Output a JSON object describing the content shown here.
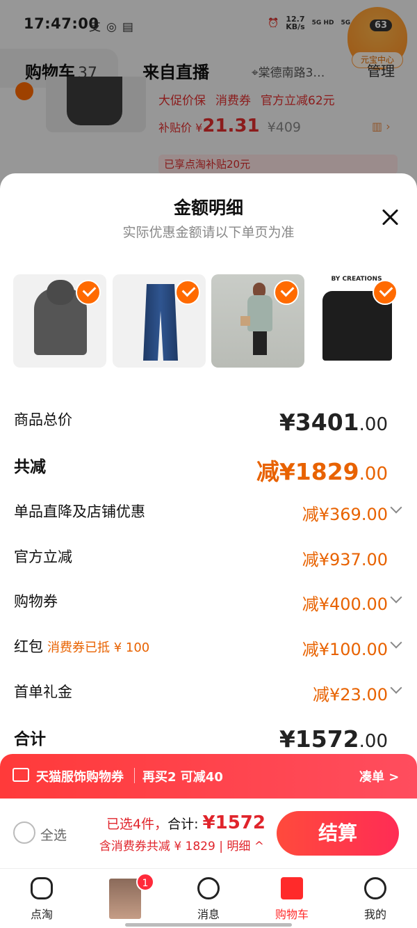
{
  "status_bar": {
    "time": "17:47:00",
    "speed_value": "12.7",
    "speed_unit": "KB/s",
    "network1": "5G HD",
    "network2": "5G HD",
    "icons": [
      "alipay-icon",
      "wechat-icon",
      "notification-icon",
      "alarm-icon",
      "wifi-icon"
    ]
  },
  "floating_badge": {
    "count": "63",
    "label": "元宝中心"
  },
  "header": {
    "tab_cart_label": "购物车",
    "tab_cart_count": "37",
    "tab_live_label": "来自直播",
    "address": "棠德南路3…",
    "manage_label": "管理"
  },
  "background_item": {
    "tags": [
      "大促价保",
      "消费券",
      "官方立减62元"
    ],
    "price_prefix": "补贴价",
    "price_symbol": "¥",
    "price": "21.31",
    "original_price": "¥409",
    "subsidy_note": "已享点淘补贴20元"
  },
  "sheet": {
    "title": "金额明细",
    "subtitle": "实际优惠金额请以下单页为准",
    "thumbnails": [
      {
        "name": "hoodie"
      },
      {
        "name": "jeans"
      },
      {
        "name": "model-photo"
      },
      {
        "name": "sweater",
        "brand_text": "BY CREATIONS"
      }
    ],
    "rows": [
      {
        "label": "商品总价",
        "value": "¥3401",
        "cents": ".00",
        "style": "total"
      },
      {
        "label": "共减",
        "value": "减¥1829",
        "cents": ".00",
        "style": "discount-total"
      },
      {
        "label": "单品直降及店铺优惠",
        "value": "减¥369",
        "cents": ".00",
        "expandable": true
      },
      {
        "label": "官方立减",
        "value": "减¥937",
        "cents": ".00",
        "expandable": false
      },
      {
        "label": "购物券",
        "value": "减¥400",
        "cents": ".00",
        "expandable": true
      },
      {
        "label": "红包",
        "note": "消费券已抵 ¥ 100",
        "value": "减¥100",
        "cents": ".00",
        "expandable": true
      },
      {
        "label": "首单礼金",
        "value": "减¥23",
        "cents": ".00",
        "expandable": true
      },
      {
        "label": "合计",
        "value": "¥1572",
        "cents": ".00",
        "style": "total"
      }
    ]
  },
  "coupon_banner": {
    "title": "天猫服饰购物券",
    "offer": "再买2 可减40",
    "action": "凑单 >"
  },
  "checkout": {
    "select_all": "全选",
    "selected_text": "已选4件，",
    "total_label": "合计:",
    "total_value": "¥1572",
    "discount_note": "含消费券共减 ¥ 1829 | 明细 ^",
    "pay_button": "结算"
  },
  "bottom_nav": {
    "items": [
      {
        "label": "点淘"
      },
      {
        "label": ""
      },
      {
        "label": "消息"
      },
      {
        "label": "购物车",
        "active": true
      },
      {
        "label": "我的"
      }
    ],
    "badge": "1"
  },
  "colors": {
    "accent": "#e86200",
    "red": "#e0242b",
    "pay_gradient_start": "#ff4a3c",
    "pay_gradient_end": "#ff2c55"
  }
}
